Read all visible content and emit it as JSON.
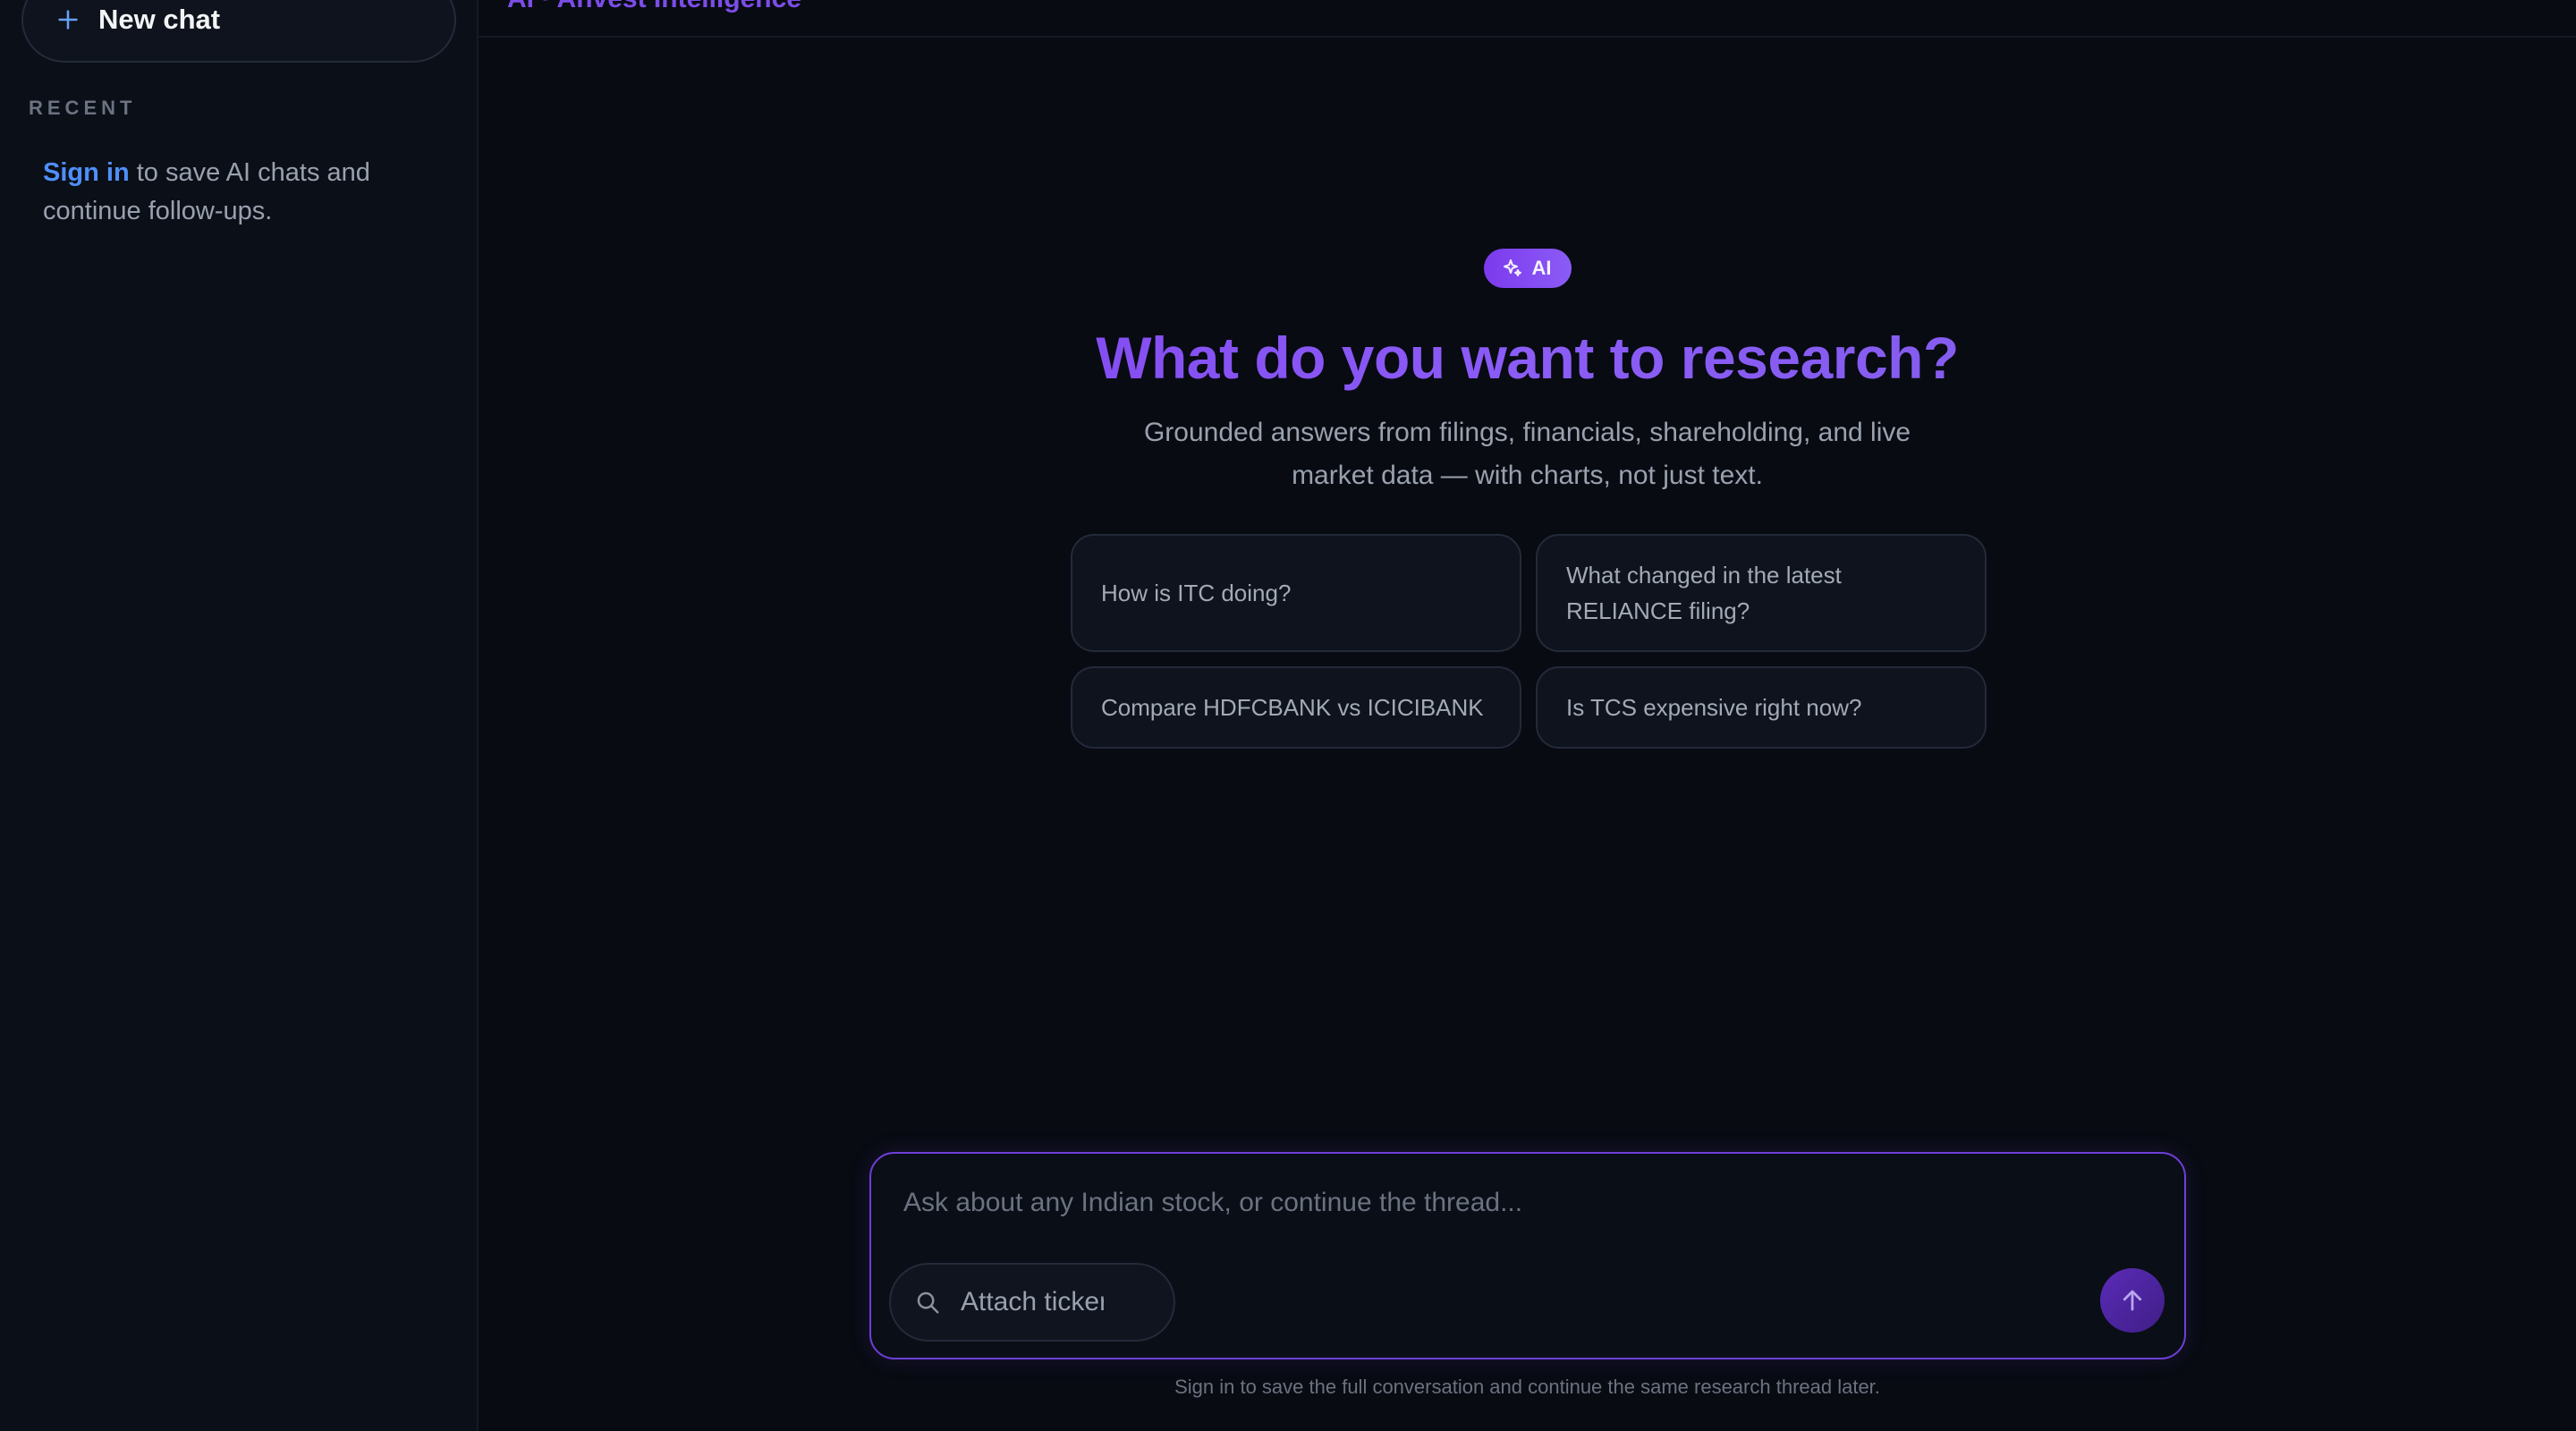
{
  "sidebar": {
    "new_chat_label": "New chat",
    "recent_label": "RECENT",
    "signin_link": "Sign in",
    "signin_text": " to save AI chats and continue follow-ups."
  },
  "topbar": {
    "title": "AI · Anvest Intelligence"
  },
  "hero": {
    "badge": "AI",
    "title": "What do you want to research?",
    "subtitle": "Grounded answers from filings, financials, shareholding, and live market data — with charts, not just text."
  },
  "suggestions": [
    "How is ITC doing?",
    "What changed in the latest RELIANCE filing?",
    "Compare HDFCBANK vs ICICIBANK",
    "Is TCS expensive right now?"
  ],
  "composer": {
    "placeholder": "Ask about any Indian stock, or continue the thread...",
    "ticker_placeholder": "Attach ticker"
  },
  "footnote": "Sign in to save the full conversation and continue the same research thread later.",
  "colors": {
    "accent": "#7c3aed",
    "link": "#4f8ff7",
    "background": "#080b12"
  }
}
